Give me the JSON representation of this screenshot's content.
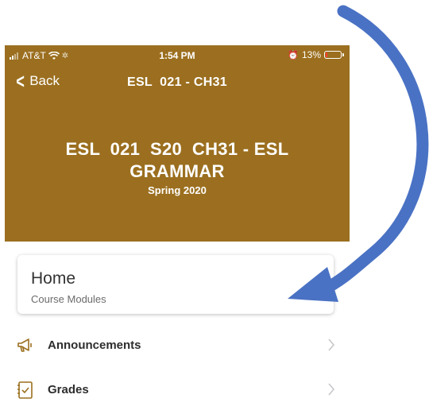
{
  "status_bar": {
    "carrier": "AT&T",
    "time": "1:54 PM",
    "battery": "13%",
    "battery_level": 0.13
  },
  "nav": {
    "back_label": "Back",
    "title": "ESL  021 - CH31"
  },
  "course": {
    "title": "ESL  021  S20  CH31 - ESL GRAMMAR",
    "term": "Spring 2020",
    "color": "#9b6f1f"
  },
  "home_card": {
    "title": "Home",
    "subtitle": "Course Modules"
  },
  "menu_items": [
    {
      "label": "Announcements",
      "icon": "megaphone-icon"
    },
    {
      "label": "Grades",
      "icon": "gradebook-icon"
    }
  ],
  "annotation": {
    "arrow_color": "#4a72c4",
    "arrow_icon": "curved-arrow-icon"
  }
}
